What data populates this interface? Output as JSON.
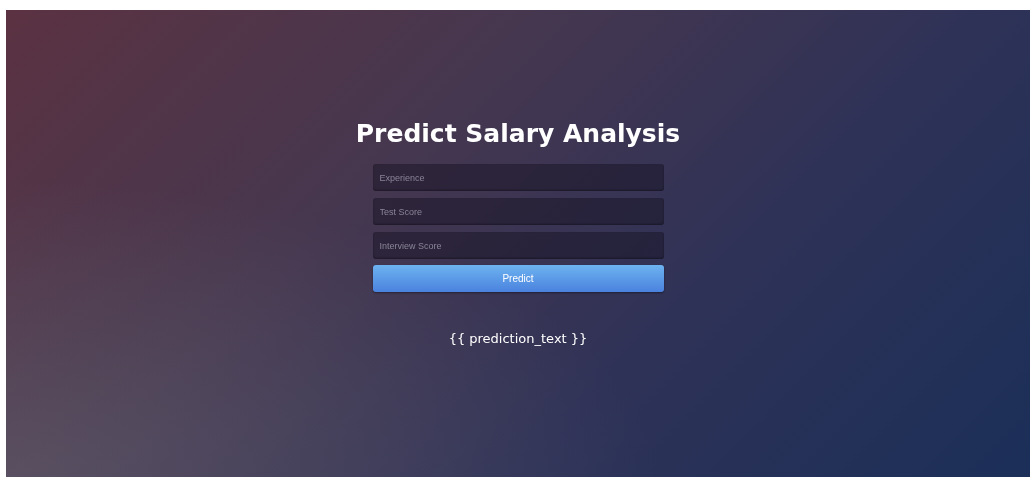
{
  "title": "Predict Salary Analysis",
  "fields": [
    {
      "placeholder": "Experience"
    },
    {
      "placeholder": "Test Score"
    },
    {
      "placeholder": "Interview Score"
    }
  ],
  "button": "Predict",
  "result": "{{ prediction_text }}"
}
